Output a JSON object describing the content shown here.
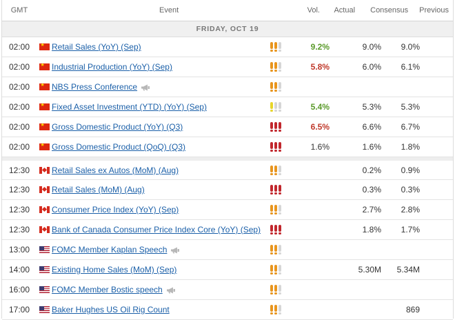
{
  "header": {
    "time": "GMT",
    "event": "Event",
    "volatility": "Vol.",
    "actual": "Actual",
    "consensus": "Consensus",
    "previous": "Previous"
  },
  "day_label": "FRIDAY, OCT 19",
  "colors": {
    "actual_better": "#5a9a2a",
    "actual_worse": "#c0392b",
    "actual_neutral": "#333333",
    "link": "#1a5fa8"
  },
  "events": [
    {
      "time": "02:00",
      "country": "cn",
      "flag_icon": "china-flag-icon",
      "name": "Retail Sales (YoY) (Sep)",
      "speech": false,
      "vol": 2,
      "actual": "9.2%",
      "actual_state": "better",
      "consensus": "9.0%",
      "previous": "9.0%"
    },
    {
      "time": "02:00",
      "country": "cn",
      "flag_icon": "china-flag-icon",
      "name": "Industrial Production (YoY) (Sep)",
      "speech": false,
      "vol": 2,
      "actual": "5.8%",
      "actual_state": "worse",
      "consensus": "6.0%",
      "previous": "6.1%"
    },
    {
      "time": "02:00",
      "country": "cn",
      "flag_icon": "china-flag-icon",
      "name": "NBS Press Conference",
      "speech": true,
      "vol": 2,
      "actual": "",
      "actual_state": "neutral",
      "consensus": "",
      "previous": ""
    },
    {
      "time": "02:00",
      "country": "cn",
      "flag_icon": "china-flag-icon",
      "name": "Fixed Asset Investment (YTD) (YoY) (Sep)",
      "speech": false,
      "vol": 1,
      "actual": "5.4%",
      "actual_state": "better",
      "consensus": "5.3%",
      "previous": "5.3%"
    },
    {
      "time": "02:00",
      "country": "cn",
      "flag_icon": "china-flag-icon",
      "name": "Gross Domestic Product (YoY) (Q3)",
      "speech": false,
      "vol": 3,
      "actual": "6.5%",
      "actual_state": "worse",
      "consensus": "6.6%",
      "previous": "6.7%"
    },
    {
      "time": "02:00",
      "country": "cn",
      "flag_icon": "china-flag-icon",
      "name": "Gross Domestic Product (QoQ) (Q3)",
      "speech": false,
      "vol": 3,
      "actual": "1.6%",
      "actual_state": "neutral",
      "consensus": "1.6%",
      "previous": "1.8%"
    },
    {
      "time": "12:30",
      "country": "ca",
      "flag_icon": "canada-flag-icon",
      "name": "Retail Sales ex Autos (MoM) (Aug)",
      "speech": false,
      "vol": 2,
      "actual": "",
      "actual_state": "neutral",
      "consensus": "0.2%",
      "previous": "0.9%",
      "separator": true
    },
    {
      "time": "12:30",
      "country": "ca",
      "flag_icon": "canada-flag-icon",
      "name": "Retail Sales (MoM) (Aug)",
      "speech": false,
      "vol": 3,
      "actual": "",
      "actual_state": "neutral",
      "consensus": "0.3%",
      "previous": "0.3%"
    },
    {
      "time": "12:30",
      "country": "ca",
      "flag_icon": "canada-flag-icon",
      "name": "Consumer Price Index (YoY) (Sep)",
      "speech": false,
      "vol": 2,
      "actual": "",
      "actual_state": "neutral",
      "consensus": "2.7%",
      "previous": "2.8%"
    },
    {
      "time": "12:30",
      "country": "ca",
      "flag_icon": "canada-flag-icon",
      "name": "Bank of Canada Consumer Price Index Core (YoY) (Sep)",
      "speech": false,
      "vol": 3,
      "actual": "",
      "actual_state": "neutral",
      "consensus": "1.8%",
      "previous": "1.7%"
    },
    {
      "time": "13:00",
      "country": "us",
      "flag_icon": "usa-flag-icon",
      "name": "FOMC Member Kaplan Speech",
      "speech": true,
      "vol": 2,
      "actual": "",
      "actual_state": "neutral",
      "consensus": "",
      "previous": ""
    },
    {
      "time": "14:00",
      "country": "us",
      "flag_icon": "usa-flag-icon",
      "name": "Existing Home Sales (MoM) (Sep)",
      "speech": false,
      "vol": 2,
      "actual": "",
      "actual_state": "neutral",
      "consensus": "5.30M",
      "previous": "5.34M"
    },
    {
      "time": "16:00",
      "country": "us",
      "flag_icon": "usa-flag-icon",
      "name": "FOMC Member Bostic speech",
      "speech": true,
      "vol": 2,
      "actual": "",
      "actual_state": "neutral",
      "consensus": "",
      "previous": ""
    },
    {
      "time": "17:00",
      "country": "us",
      "flag_icon": "usa-flag-icon",
      "name": "Baker Hughes US Oil Rig Count",
      "speech": false,
      "vol": 2,
      "actual": "",
      "actual_state": "neutral",
      "consensus": "",
      "previous": "869"
    }
  ]
}
